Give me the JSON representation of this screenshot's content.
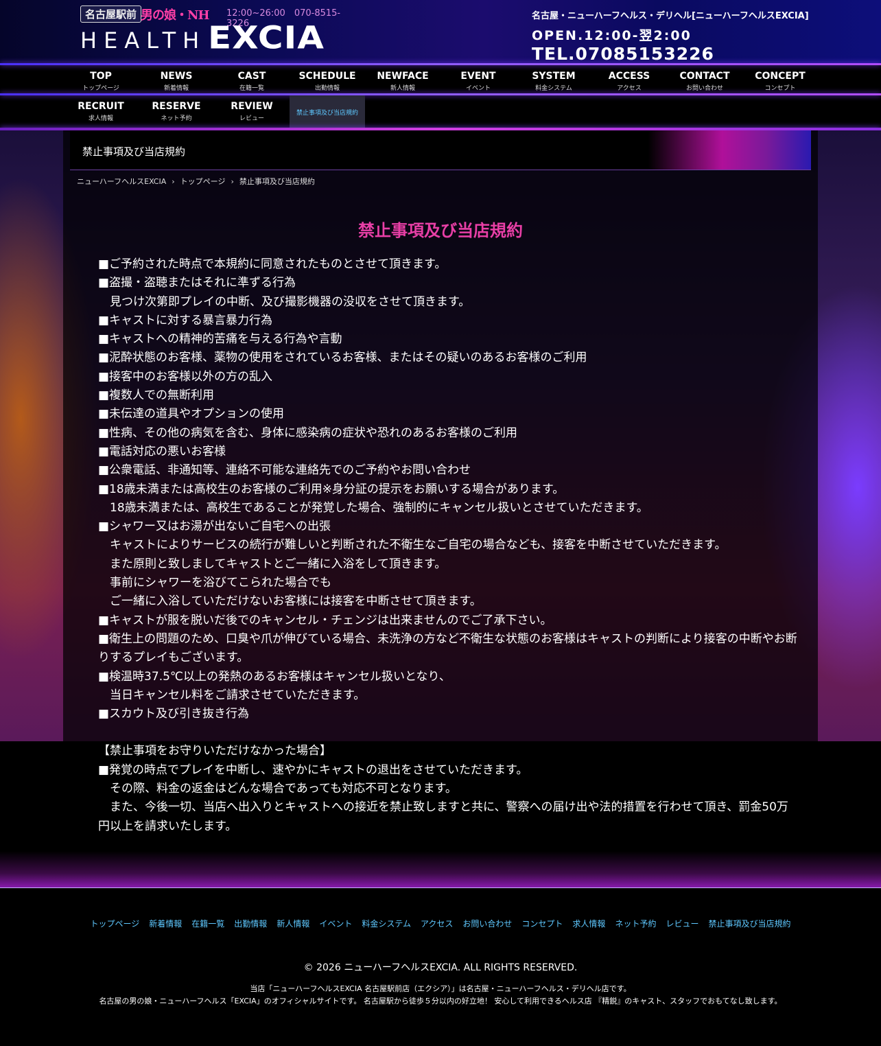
{
  "header": {
    "logo_tag": "名古屋駅前",
    "logo_nh": "男の娘・NH",
    "logo_hours": "12:00~26:00　070-8515-3226",
    "logo_health": "HEALTH",
    "logo_excia": "EXCIA",
    "info_line1": "名古屋・ニューハーフヘルス・デリヘル[ニューハーフヘルスEXCIA]",
    "info_line2": "OPEN.12:00-翌2:00",
    "info_line3": "TEL.07085153226"
  },
  "nav": {
    "row1": [
      {
        "en": "TOP",
        "ja": "トップページ"
      },
      {
        "en": "NEWS",
        "ja": "新着情報"
      },
      {
        "en": "CAST",
        "ja": "在籍一覧"
      },
      {
        "en": "SCHEDULE",
        "ja": "出勤情報"
      },
      {
        "en": "NEWFACE",
        "ja": "新人情報"
      },
      {
        "en": "EVENT",
        "ja": "イベント"
      },
      {
        "en": "SYSTEM",
        "ja": "料金システム"
      },
      {
        "en": "ACCESS",
        "ja": "アクセス"
      },
      {
        "en": "CONTACT",
        "ja": "お問い合わせ"
      },
      {
        "en": "CONCEPT",
        "ja": "コンセプト"
      }
    ],
    "row2": [
      {
        "en": "RECRUIT",
        "ja": "求人情報"
      },
      {
        "en": "RESERVE",
        "ja": "ネット予約"
      },
      {
        "en": "REVIEW",
        "ja": "レビュー"
      }
    ],
    "current": "禁止事項及び当店規約"
  },
  "page": {
    "title_bar": "禁止事項及び当店規約",
    "breadcrumb": [
      "ニューハーフヘルスEXCIA",
      "トップページ",
      "禁止事項及び当店規約"
    ],
    "heading": "禁止事項及び当店規約",
    "lines": [
      "■ご予約された時点で本規約に同意されたものとさせて頂きます。",
      "■盗撮・盗聴またはそれに準ずる行為",
      "　見つけ次第即プレイの中断、及び撮影機器の没収をさせて頂きます。",
      "■キャストに対する暴言暴力行為",
      "■キャストへの精神的苦痛を与える行為や言動",
      "■泥酔状態のお客様、薬物の使用をされているお客様、またはその疑いのあるお客様のご利用",
      "■接客中のお客様以外の方の乱入",
      "■複数人での無断利用",
      "■未伝達の道具やオプションの使用",
      "■性病、その他の病気を含む、身体に感染病の症状や恐れのあるお客様のご利用",
      "■電話対応の悪いお客様",
      "■公衆電話、非通知等、連絡不可能な連絡先でのご予約やお問い合わせ",
      "■18歳未満または高校生のお客様のご利用※身分証の提示をお願いする場合があります。",
      "　18歳未満または、高校生であることが発覚した場合、強制的にキャンセル扱いとさせていただきます。",
      "■シャワー又はお湯が出ないご自宅への出張",
      "　キャストによりサービスの続行が難しいと判断された不衛生なご自宅の場合なども、接客を中断させていただきます。",
      "　また原則と致しましてキャストとご一緒に入浴をして頂きます。",
      "　事前にシャワーを浴びてこられた場合でも",
      "　ご一緒に入浴していただけないお客様には接客を中断させて頂きます。",
      "■キャストが服を脱いだ後でのキャンセル・チェンジは出来ませんのでご了承下さい。",
      "■衛生上の問題のため、口臭や爪が伸びている場合、未洗浄の方など不衛生な状態のお客様はキャストの判断により接客の中断やお断りするプレイもございます。",
      "■検温時37.5℃以上の発熱のあるお客様はキャンセル扱いとなり、",
      "　当日キャンセル料をご請求させていただきます。",
      "■スカウト及び引き抜き行為",
      "",
      "【禁止事項をお守りいただけなかった場合】",
      "■発覚の時点でプレイを中断し、速やかにキャストの退出をさせていただきます。",
      "　その際、料金の返金はどんな場合であっても対応不可となります。",
      "　また、今後一切、当店へ出入りとキャストへの接近を禁止致しますと共に、警察への届け出や法的措置を行わせて頂き、罰金50万円以上を請求いたします。"
    ]
  },
  "footer": {
    "links": [
      "トップページ",
      "新着情報",
      "在籍一覧",
      "出勤情報",
      "新人情報",
      "イベント",
      "料金システム",
      "アクセス",
      "お問い合わせ",
      "コンセプト",
      "求人情報",
      "ネット予約",
      "レビュー",
      "禁止事項及び当店規約"
    ],
    "copyright": "© 2026 ニューハーフヘルスEXCIA. ALL RIGHTS RESERVED.",
    "desc1": "当店「ニューハーフヘルスEXCIA 名古屋駅前店（エクシア）」は名古屋・ニューハーフヘルス・デリヘル店です。",
    "desc2": "名古屋の男の娘・ニューハーフヘルス「EXCIA」のオフィシャルサイトです。 名古屋駅から徒歩５分以内の好立地！ 安心して利用できるヘルス店 『精鋭』のキャスト、スタッフでおもてなし致します。"
  }
}
